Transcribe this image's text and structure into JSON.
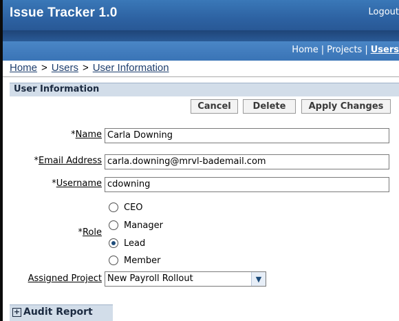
{
  "app": {
    "title": "Issue Tracker 1.0",
    "logout": "Logout"
  },
  "topnav": {
    "home": "Home",
    "projects": "Projects",
    "users": "Users"
  },
  "breadcrumb": {
    "home": "Home",
    "users": "Users",
    "current": "User Information",
    "sep": ">"
  },
  "section": {
    "title": "User Information"
  },
  "buttons": {
    "cancel": "Cancel",
    "delete": "Delete",
    "apply": "Apply Changes"
  },
  "form": {
    "name": {
      "label": "Name",
      "value": "Carla Downing"
    },
    "email": {
      "label": "Email Address",
      "value": "carla.downing@mrvl-bademail.com"
    },
    "username": {
      "label": "Username",
      "value": "cdowning"
    },
    "role": {
      "label": "Role",
      "options": [
        "CEO",
        "Manager",
        "Lead",
        "Member"
      ],
      "selected": "Lead"
    },
    "project": {
      "label": "Assigned Project",
      "value": "New Payroll Rollout"
    },
    "required_mark": "*"
  },
  "audit": {
    "label": "Audit Report"
  },
  "colors": {
    "header": "#2d62a2",
    "nav": "#3a74b6",
    "section_bg": "#d2dde9",
    "link": "#1f3f6e"
  }
}
